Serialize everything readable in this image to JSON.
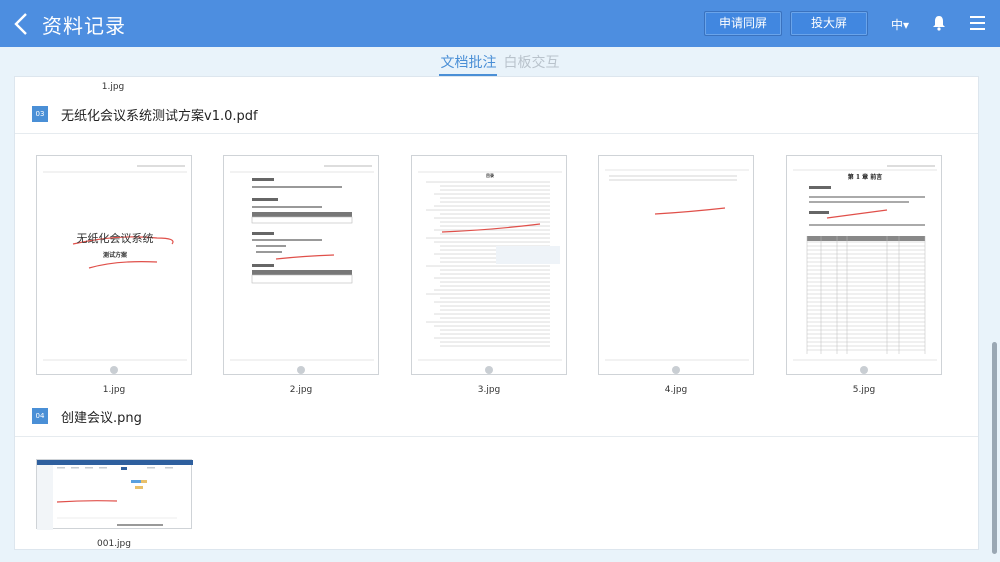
{
  "header": {
    "title": "资料记录",
    "sync_button": "申请同屏",
    "big_screen_button": "投大屏",
    "language": "中▾"
  },
  "tabs": [
    {
      "label": "文档批注",
      "active": true
    },
    {
      "label": "白板交互",
      "active": false
    }
  ],
  "content": {
    "top_caption": "1.jpg",
    "sections": [
      {
        "number": "03",
        "title": "无纸化会议系统测试方案v1.0.pdf",
        "pages": [
          {
            "caption": "1.jpg",
            "doc_title": "无纸化会议系统",
            "doc_subtitle": "测试方案"
          },
          {
            "caption": "2.jpg"
          },
          {
            "caption": "3.jpg",
            "doc_heading": "目录"
          },
          {
            "caption": "4.jpg"
          },
          {
            "caption": "5.jpg",
            "doc_heading": "第 1 章 前言"
          }
        ]
      },
      {
        "number": "04",
        "title": "创建会议.png",
        "pages": [
          {
            "caption": "001.jpg"
          }
        ]
      }
    ]
  },
  "colors": {
    "header": "#4d8ee0",
    "accent": "#4a8fd6",
    "annotation": "#e0504a",
    "background": "#e9f3fa"
  }
}
